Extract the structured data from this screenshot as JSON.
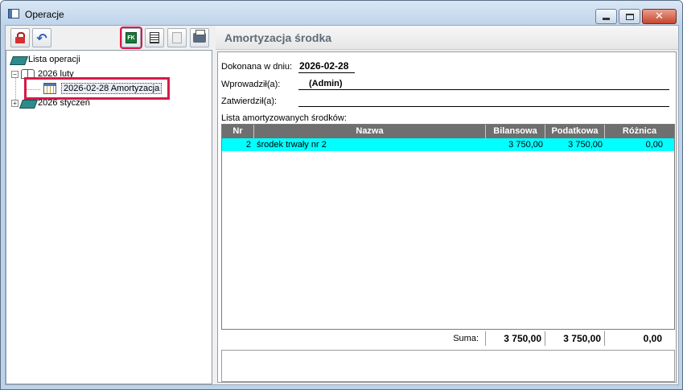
{
  "window": {
    "title": "Operacje"
  },
  "toolbar": {
    "buttons": [
      {
        "icon": "lock-icon"
      },
      {
        "icon": "undo-icon"
      },
      {
        "icon": "fk-icon",
        "label": "FK"
      },
      {
        "icon": "document-icon"
      },
      {
        "icon": "document-disabled-icon"
      },
      {
        "icon": "printer-icon"
      }
    ]
  },
  "tree": {
    "root": "Lista operacji",
    "items": [
      {
        "label": "2026 luty",
        "expander": "−"
      },
      {
        "label": "2026-02-28  Amortyzacja"
      },
      {
        "label": "2026 styczeń",
        "expander": "+"
      }
    ]
  },
  "panel": {
    "title": "Amortyzacja środka",
    "done_on_label": "Dokonana w dniu:",
    "done_on_value": "2026-02-28",
    "entered_by_label": "Wprowadził(a):",
    "entered_by_value": "(Admin)",
    "approved_by_label": "Zatwierdził(a):",
    "approved_by_value": "",
    "list_label": "Lista amortyzowanych środków:"
  },
  "grid": {
    "headers": [
      "Nr",
      "Nazwa",
      "Bilansowa",
      "Podatkowa",
      "Różnica"
    ],
    "rows": [
      {
        "nr": "2",
        "nazwa": "środek trwały nr 2",
        "bilansowa": "3 750,00",
        "podatkowa": "3 750,00",
        "roznica": "0,00"
      }
    ],
    "sum": {
      "label": "Suma:",
      "bilansowa": "3 750,00",
      "podatkowa": "3 750,00",
      "roznica": "0,00"
    }
  },
  "colors": {
    "selected_row": "#00ffff",
    "highlight": "#d8194a",
    "header": "#6f6f6f"
  }
}
